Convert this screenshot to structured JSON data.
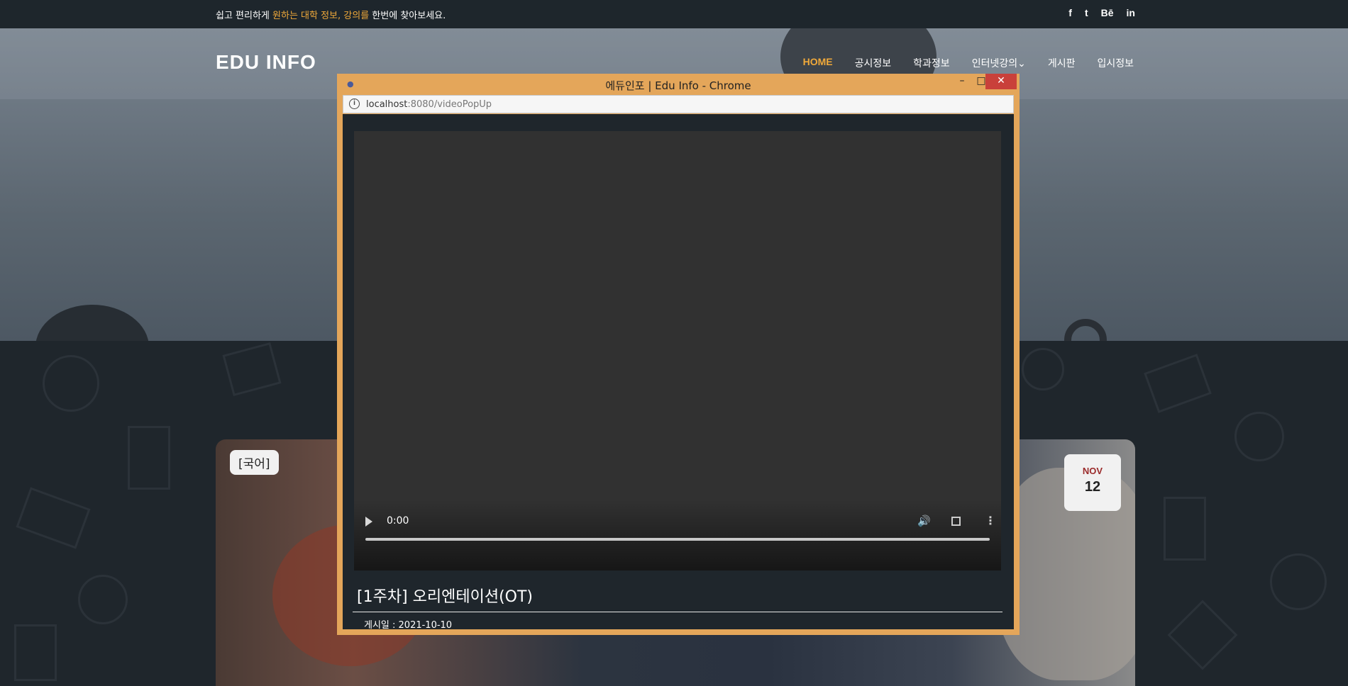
{
  "topbar": {
    "msg_pre": "쉽고 편리하게 ",
    "msg_highlight": "원하는 대학 정보, 강의를",
    "msg_post": " 한번에 찾아보세요.",
    "social": [
      "f",
      "t",
      "Bē",
      "in"
    ]
  },
  "site": {
    "logo": "EDU INFO",
    "nav": [
      "HOME",
      "공시정보",
      "학과정보",
      "인터넷강의⌄",
      "게시판",
      "입시정보"
    ]
  },
  "card": {
    "tag": "[국어]",
    "month": "NOV",
    "day": "12"
  },
  "popup": {
    "title": "에듀인포 | Edu Info - Chrome",
    "url_host": "localhost",
    "url_path": ":8080/videoPopUp",
    "video_time": "0:00",
    "video_title": "[1주차] 오리엔테이션(OT)",
    "post_date": "게시일 : 2021-10-10"
  },
  "colors": {
    "accent": "#f0a93a",
    "window_frame": "#e4a65a",
    "close_button": "#c9403a",
    "dark_bg": "#1f262c"
  },
  "icons": [
    "facebook-icon",
    "twitter-icon",
    "behance-icon",
    "linkedin-icon",
    "info-icon",
    "play-icon",
    "volume-icon",
    "fullscreen-icon",
    "more-icon"
  ]
}
